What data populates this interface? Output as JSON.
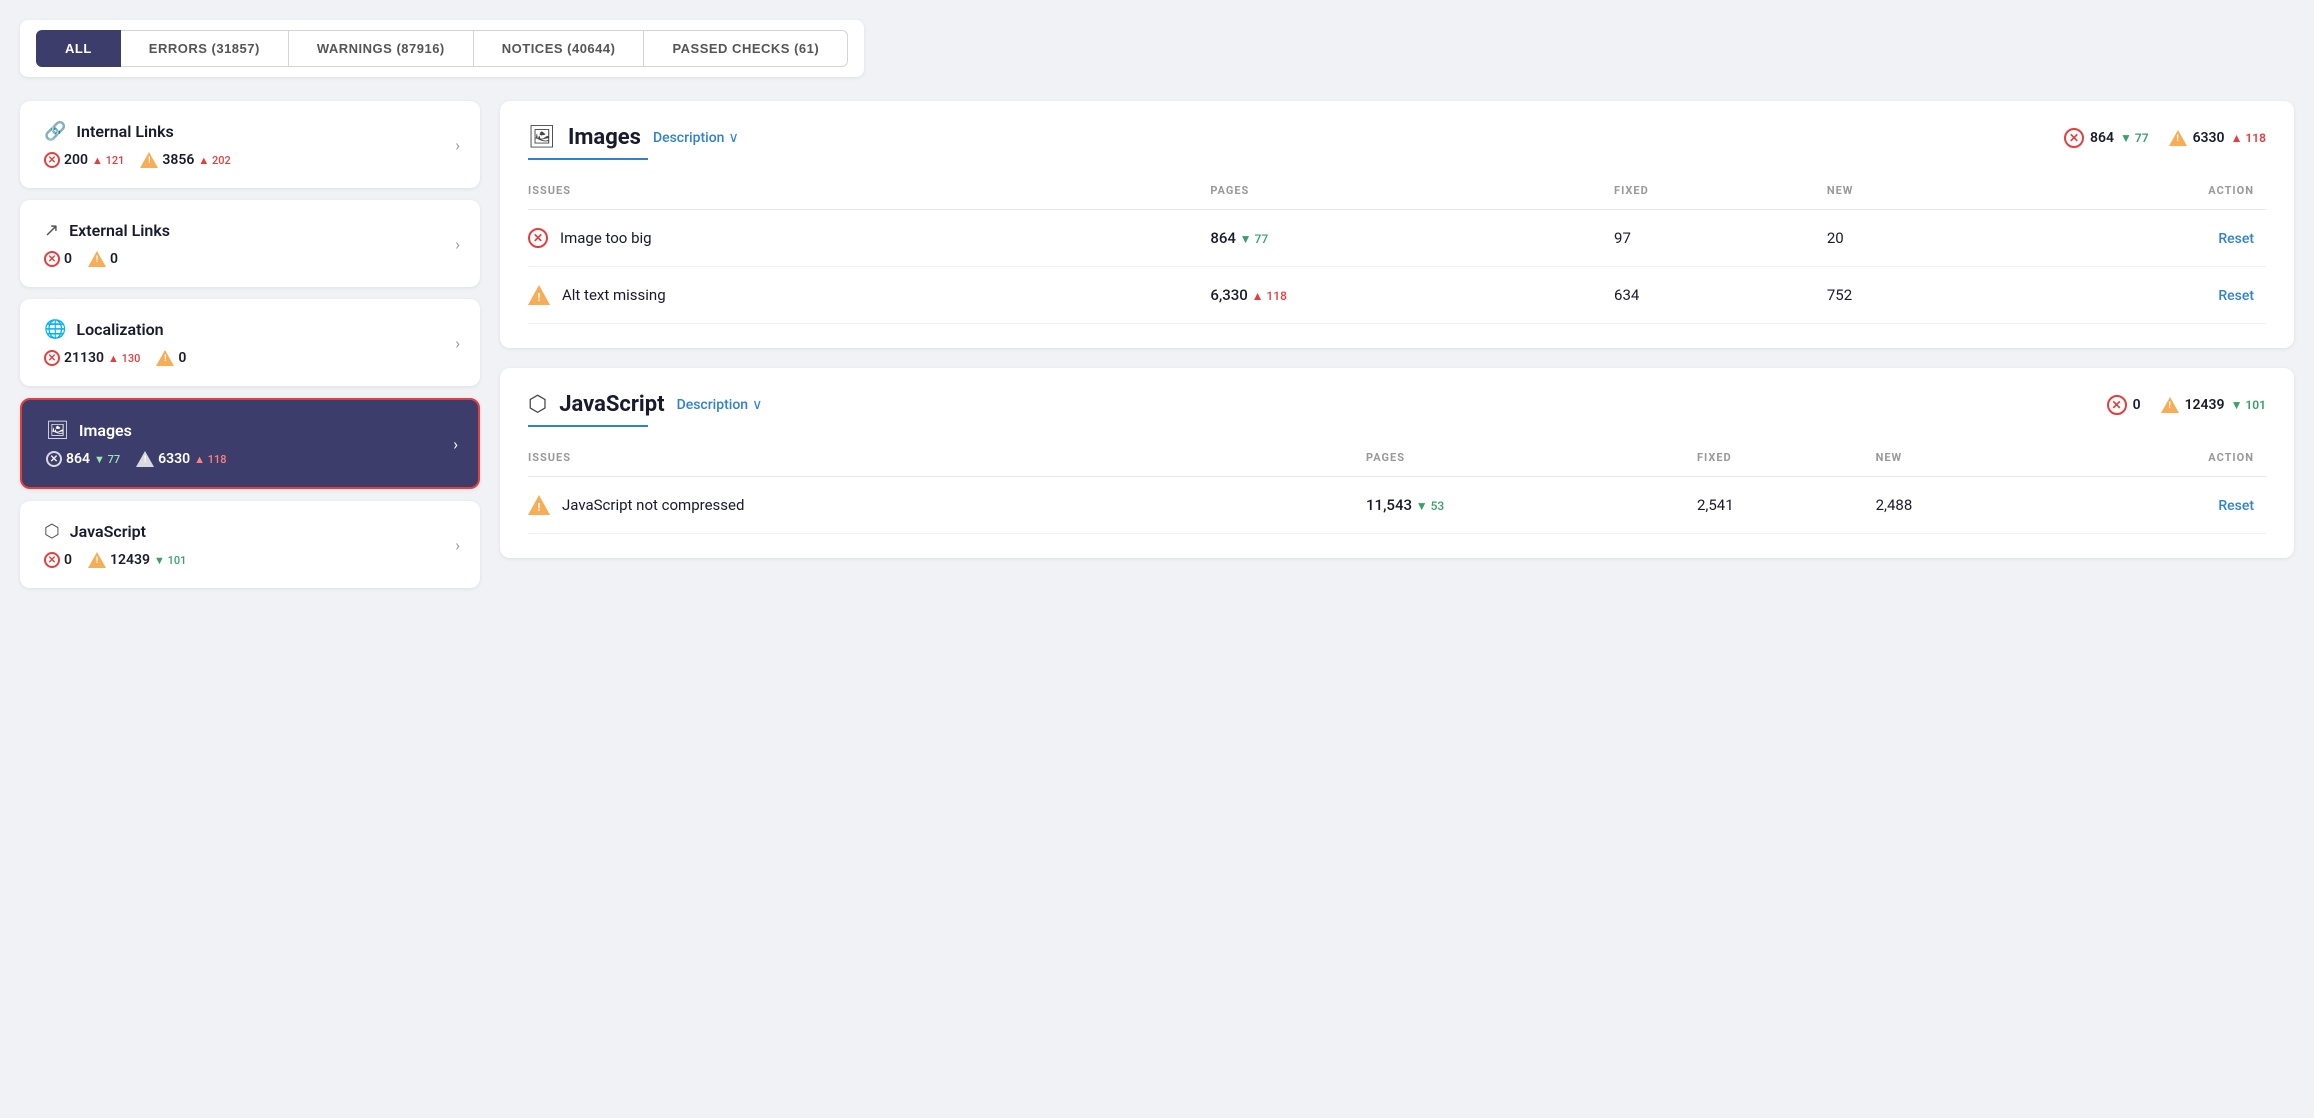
{
  "filter_tabs": {
    "tabs": [
      {
        "id": "all",
        "label": "ALL",
        "active": true
      },
      {
        "id": "errors",
        "label": "ERRORS (31857)",
        "active": false
      },
      {
        "id": "warnings",
        "label": "WARNINGS (87916)",
        "active": false
      },
      {
        "id": "notices",
        "label": "NOTICES (40644)",
        "active": false
      },
      {
        "id": "passed",
        "label": "PASSED CHECKS (61)",
        "active": false
      }
    ]
  },
  "sidebar": {
    "items": [
      {
        "id": "internal-links",
        "icon": "🔗",
        "title": "Internal Links",
        "active": false,
        "error_count": "200",
        "error_trend": "▲ 121",
        "error_trend_dir": "up",
        "warning_count": "3856",
        "warning_trend": "▲ 202",
        "warning_trend_dir": "up"
      },
      {
        "id": "external-links",
        "icon": "↗",
        "title": "External Links",
        "active": false,
        "error_count": "0",
        "error_trend": "",
        "error_trend_dir": "",
        "warning_count": "0",
        "warning_trend": "",
        "warning_trend_dir": ""
      },
      {
        "id": "localization",
        "icon": "🌐",
        "title": "Localization",
        "active": false,
        "error_count": "21130",
        "error_trend": "▲ 130",
        "error_trend_dir": "up",
        "warning_count": "0",
        "warning_trend": "",
        "warning_trend_dir": ""
      },
      {
        "id": "images",
        "icon": "🖼",
        "title": "Images",
        "active": true,
        "error_count": "864",
        "error_trend": "▼ 77",
        "error_trend_dir": "down",
        "warning_count": "6330",
        "warning_trend": "▲ 118",
        "warning_trend_dir": "up"
      },
      {
        "id": "javascript",
        "icon": "⬡",
        "title": "JavaScript",
        "active": false,
        "error_count": "0",
        "error_trend": "",
        "error_trend_dir": "",
        "warning_count": "12439",
        "warning_trend": "▼ 101",
        "warning_trend_dir": "down"
      }
    ]
  },
  "right_panels": [
    {
      "id": "images-panel",
      "icon": "🖼",
      "title": "Images",
      "description_label": "Description",
      "header_error_count": "864",
      "header_error_trend": "▼ 77",
      "header_error_trend_dir": "down",
      "header_warning_count": "6330",
      "header_warning_trend": "▲ 118",
      "header_warning_trend_dir": "up",
      "columns": {
        "issues": "ISSUES",
        "pages": "PAGES",
        "fixed": "FIXED",
        "new": "NEW",
        "action": "ACTION"
      },
      "rows": [
        {
          "type": "error",
          "issue": "Image too big",
          "pages": "864",
          "pages_trend": "▼ 77",
          "pages_trend_dir": "down",
          "fixed": "97",
          "new": "20",
          "action": "Reset"
        },
        {
          "type": "warning",
          "issue": "Alt text missing",
          "pages": "6,330",
          "pages_trend": "▲ 118",
          "pages_trend_dir": "up",
          "fixed": "634",
          "new": "752",
          "action": "Reset"
        }
      ]
    },
    {
      "id": "javascript-panel",
      "icon": "⬡",
      "title": "JavaScript",
      "description_label": "Description",
      "header_error_count": "0",
      "header_error_trend": "",
      "header_error_trend_dir": "",
      "header_warning_count": "12439",
      "header_warning_trend": "▼ 101",
      "header_warning_trend_dir": "down",
      "columns": {
        "issues": "ISSUES",
        "pages": "PAGES",
        "fixed": "FIXED",
        "new": "NEW",
        "action": "ACTION"
      },
      "rows": [
        {
          "type": "warning",
          "issue": "JavaScript not compressed",
          "pages": "11,543",
          "pages_trend": "▼ 53",
          "pages_trend_dir": "down",
          "fixed": "2,541",
          "new": "2,488",
          "action": "Reset"
        }
      ]
    }
  ],
  "icons": {
    "chevron_right": "›",
    "chevron_down": "∨",
    "error_x": "✕",
    "warning_ex": "!",
    "trend_up": "▲",
    "trend_down": "▼"
  }
}
